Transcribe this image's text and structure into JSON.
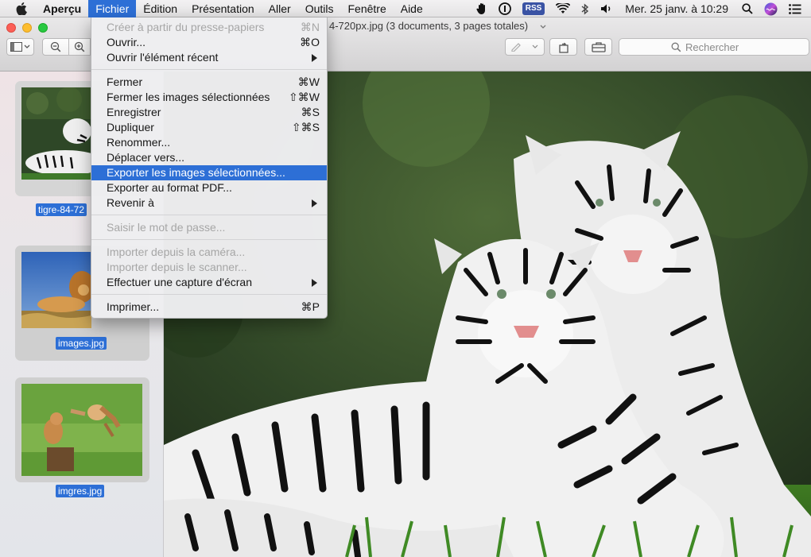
{
  "menubar": {
    "app": "Aperçu",
    "items": [
      "Fichier",
      "Édition",
      "Présentation",
      "Aller",
      "Outils",
      "Fenêtre",
      "Aide"
    ],
    "rss": "RSS",
    "clock": "Mer. 25 janv. à  10:29"
  },
  "window": {
    "title": "4-720px.jpg (3 documents, 3 pages totales)",
    "search_placeholder": "Rechercher"
  },
  "sidebar": {
    "thumbnails": [
      {
        "label": "tigre-84-72"
      },
      {
        "label": "images.jpg"
      },
      {
        "label": "imgres.jpg"
      }
    ]
  },
  "file_menu": {
    "items": [
      {
        "label": "Créer à partir du presse-papiers",
        "shortcut": "⌘N",
        "state": "disabled"
      },
      {
        "label": "Ouvrir...",
        "shortcut": "⌘O"
      },
      {
        "label": "Ouvrir l'élément récent",
        "submenu": true
      },
      {
        "label": "Fermer",
        "shortcut": "⌘W"
      },
      {
        "label": "Fermer les images sélectionnées",
        "shortcut": "⇧⌘W"
      },
      {
        "label": "Enregistrer",
        "shortcut": "⌘S"
      },
      {
        "label": "Dupliquer",
        "shortcut": "⇧⌘S"
      },
      {
        "label": "Renommer..."
      },
      {
        "label": "Déplacer vers..."
      },
      {
        "label": "Exporter les images sélectionnées...",
        "state": "selected"
      },
      {
        "label": "Exporter au format PDF..."
      },
      {
        "label": "Revenir à",
        "submenu": true
      },
      {
        "label": "Saisir le mot de passe...",
        "state": "disabled"
      },
      {
        "label": "Importer depuis la caméra...",
        "state": "disabled"
      },
      {
        "label": "Importer depuis le scanner...",
        "state": "disabled"
      },
      {
        "label": "Effectuer une capture d'écran",
        "submenu": true
      },
      {
        "label": "Imprimer...",
        "shortcut": "⌘P"
      }
    ]
  },
  "colors": {
    "accent": "#2d6fd6",
    "menubar_bg": "#e9e8e9"
  }
}
